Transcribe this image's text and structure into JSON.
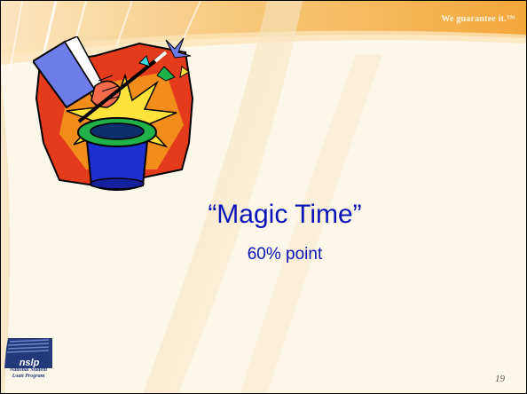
{
  "header": {
    "tagline": "We guarantee it.™"
  },
  "slide": {
    "title": "“Magic Time”",
    "subtitle": "60% point",
    "page_number": "19"
  },
  "logo": {
    "mark_text": "nslp",
    "line1": "National Student",
    "line2": "Loan Program"
  },
  "colors": {
    "title": "#0a14b8",
    "background": "#fdf7ea",
    "accent_orange": "#f5a623",
    "logo_blue": "#23397a"
  },
  "icons": [
    "magic-hat-clipart-icon",
    "nslp-logo-icon"
  ]
}
